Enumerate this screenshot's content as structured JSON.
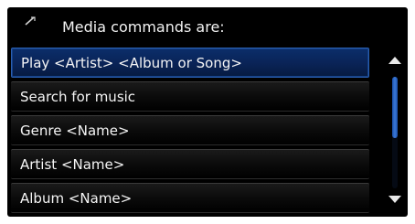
{
  "header": {
    "title": "Media commands are:",
    "icon": "voice-command-icon"
  },
  "commands": [
    {
      "label": "Play <Artist> <Album or Song>",
      "selected": true
    },
    {
      "label": "Search for music",
      "selected": false
    },
    {
      "label": "Genre <Name>",
      "selected": false
    },
    {
      "label": "Artist <Name>",
      "selected": false
    },
    {
      "label": "Album <Name>",
      "selected": false
    }
  ],
  "scrollbar": {
    "position": 0,
    "visible_fraction": 0.55
  },
  "colors": {
    "background": "#000000",
    "selected_accent": "#2b5fb0",
    "text": "#f5f5f5"
  }
}
